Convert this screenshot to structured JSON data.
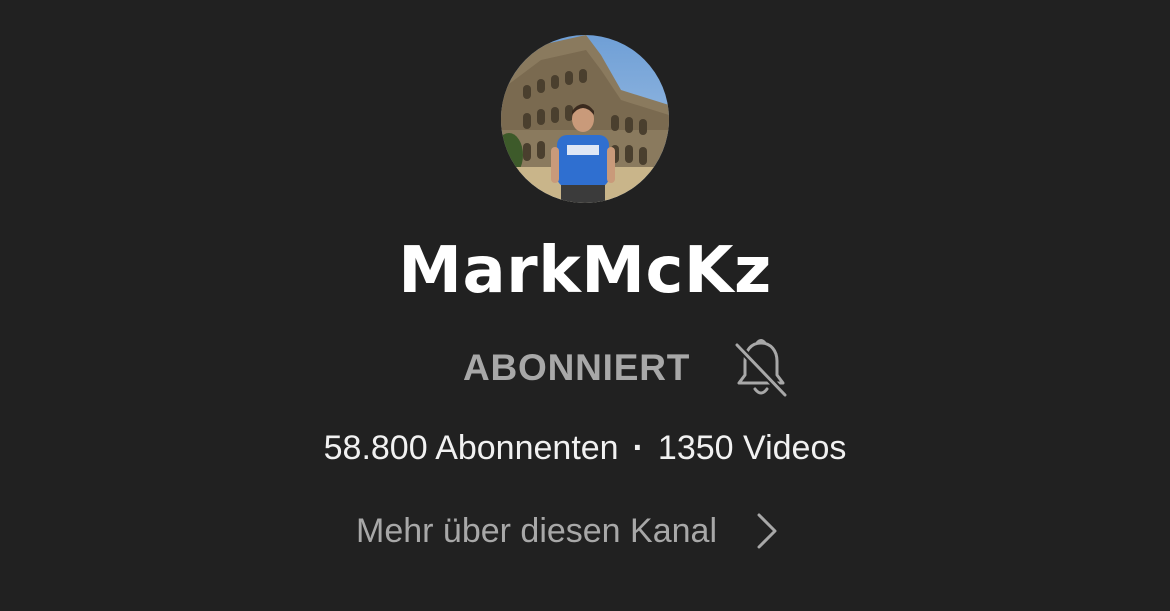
{
  "channel": {
    "name": "MarkMcKz",
    "subscribe_state": "ABONNIERT",
    "subscribers": "58.800 Abonnenten",
    "separator": "·",
    "videos": "1350 Videos",
    "more_link": "Mehr über diesen Kanal"
  },
  "icons": {
    "notification": "bell-off-icon",
    "more": "chevron-right-icon",
    "avatar": "avatar-photo"
  },
  "colors": {
    "background": "#212121",
    "primary_text": "#ffffff",
    "secondary_text": "#a8a8a8"
  }
}
